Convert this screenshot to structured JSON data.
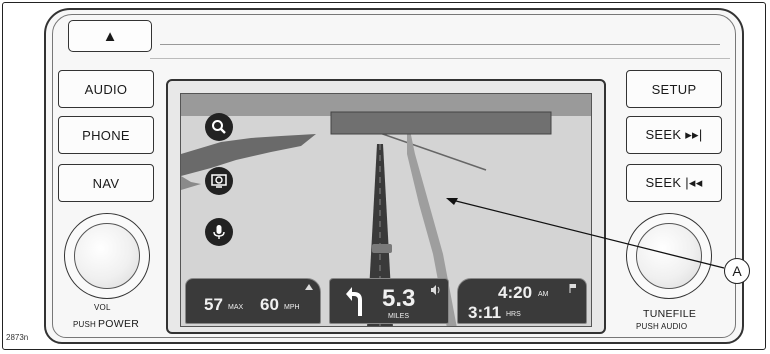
{
  "eject_button": {
    "glyph": "▲"
  },
  "left_buttons": [
    {
      "label": "AUDIO"
    },
    {
      "label": "PHONE"
    },
    {
      "label": "NAV"
    }
  ],
  "right_buttons": [
    {
      "label": "SETUP"
    },
    {
      "label": "SEEK ▸▸|"
    },
    {
      "label": "SEEK |◂◂"
    }
  ],
  "left_knob": {
    "top_label": "VOL",
    "push_label": "PUSH",
    "main_label": "POWER"
  },
  "right_knob": {
    "main_label": "TUNEFILE",
    "push_label": "PUSH AUDIO"
  },
  "screen": {
    "icons": [
      "search-icon",
      "map-zoom-icon",
      "voice-icon"
    ],
    "speed_panel": {
      "speed_limit": "57",
      "limit_unit": "MAX",
      "current_speed": "60",
      "speed_unit": "MPH"
    },
    "turn_panel": {
      "distance": "5.3",
      "distance_unit": "MILES"
    },
    "time_panel": {
      "arrival_time": "4:20",
      "arrival_suffix": "AM",
      "remaining_time": "3:11",
      "remaining_unit": "HRS"
    }
  },
  "callout": {
    "label": "A"
  },
  "figure_id": "2873n"
}
